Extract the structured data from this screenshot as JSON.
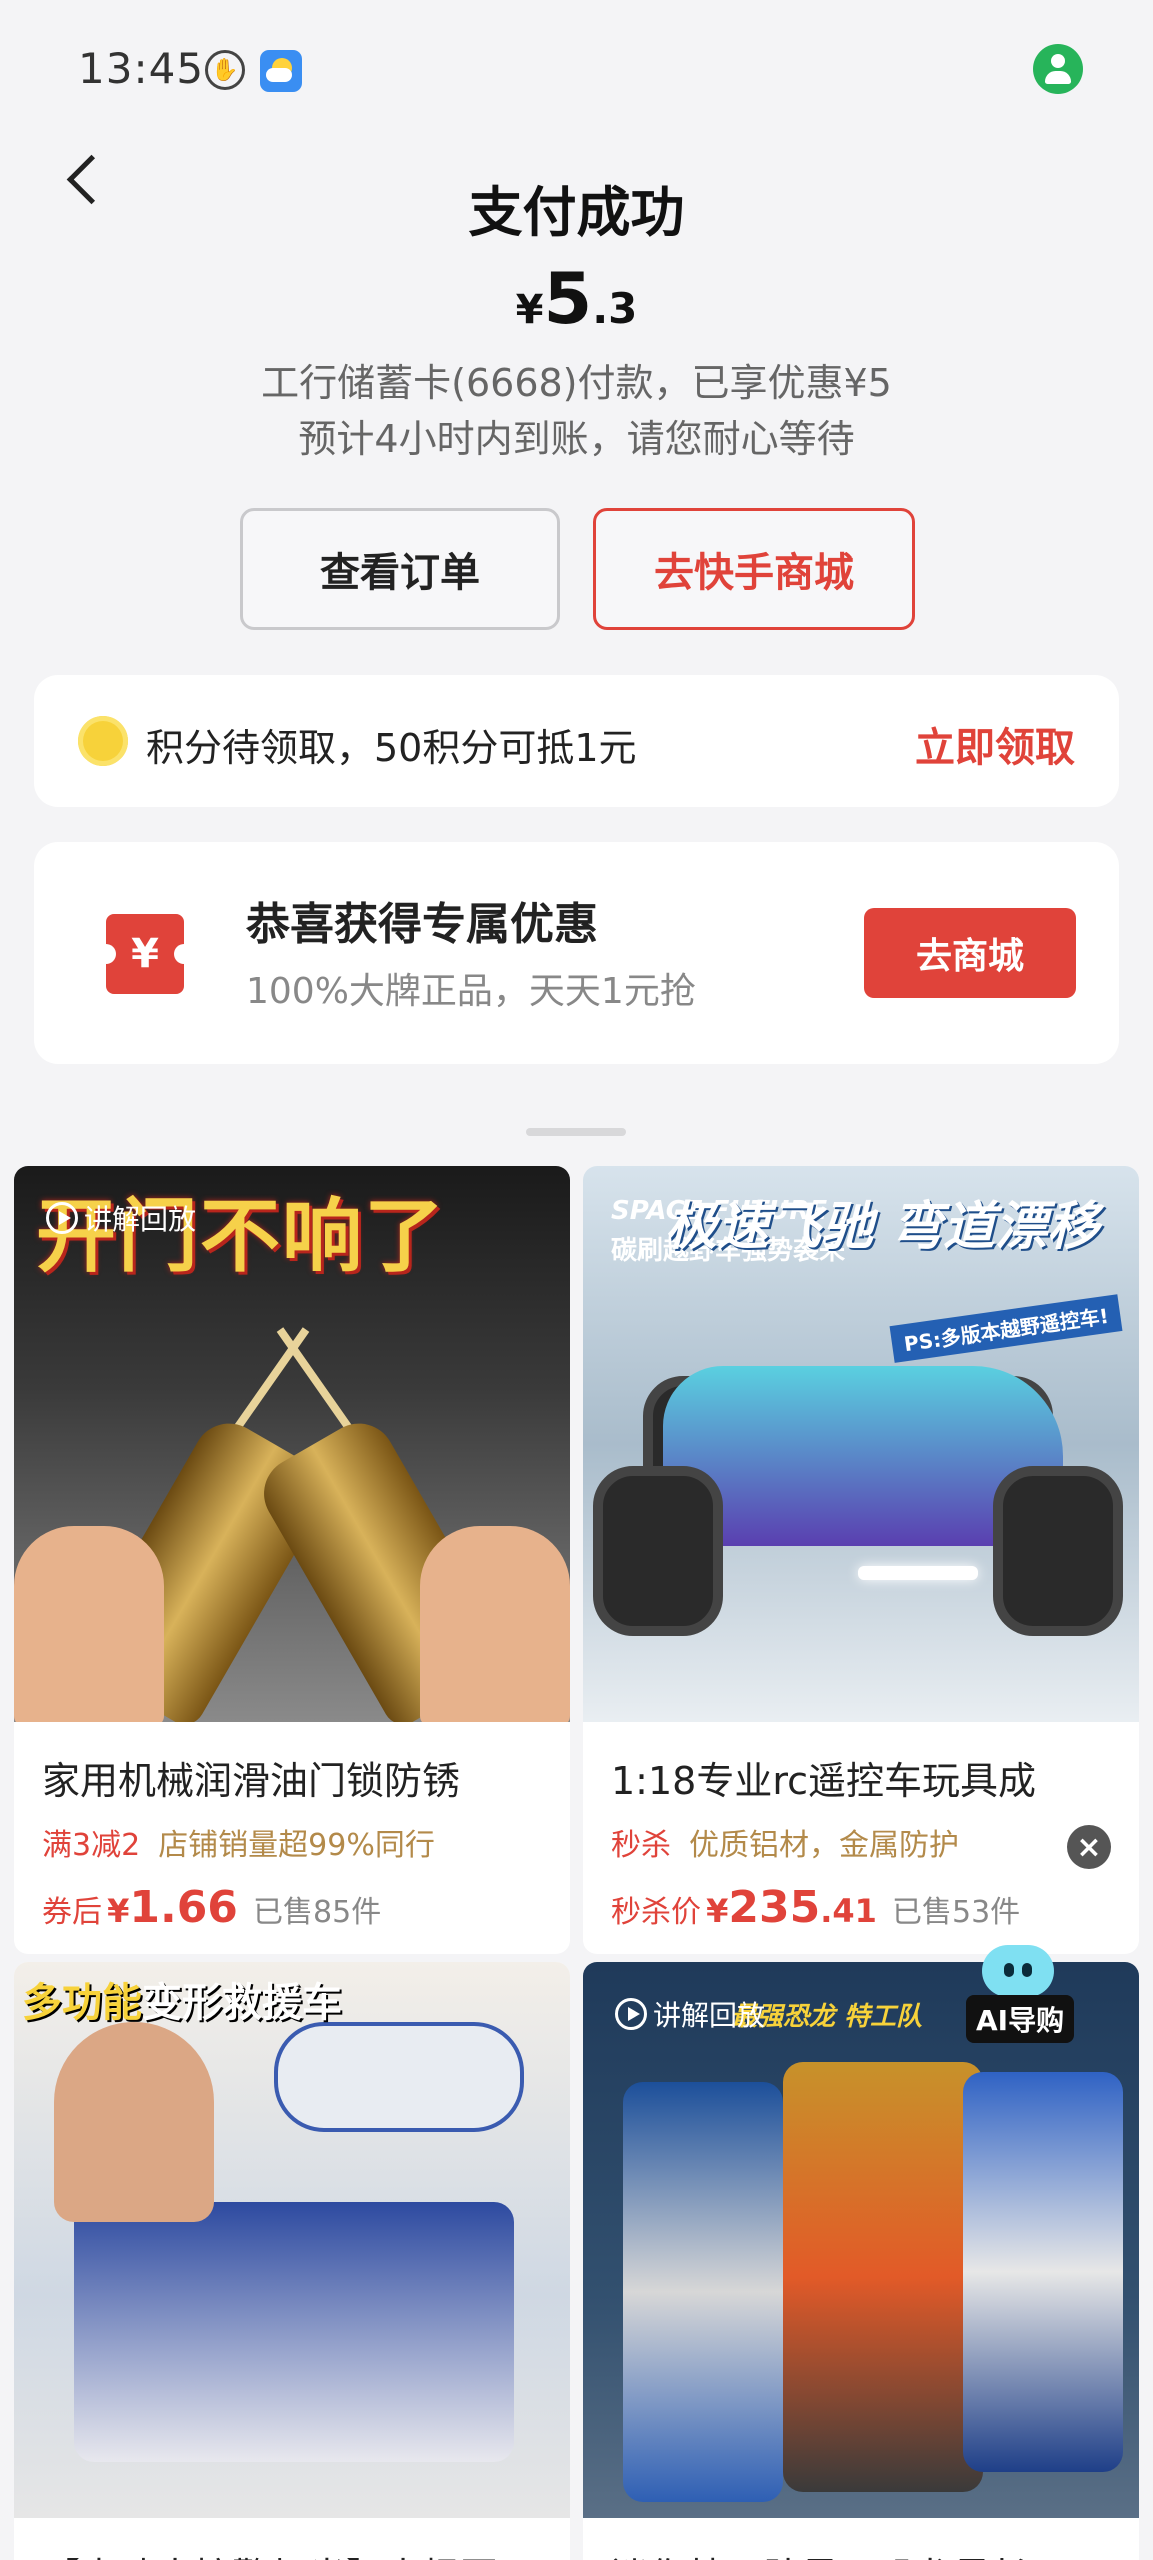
{
  "status_bar": {
    "time": "13:45"
  },
  "header": {
    "title": "支付成功",
    "currency": "¥",
    "amount_int": "5",
    "amount_dec": ".3",
    "pay_line1": "工行储蓄卡(6668)付款，已享优惠¥5",
    "pay_line2": "预计4小时内到账，请您耐心等待"
  },
  "actions": {
    "view_order": "查看订单",
    "go_mall": "去快手商城"
  },
  "points": {
    "text": "积分待领取，50积分可抵1元",
    "claim": "立即领取"
  },
  "coupon": {
    "icon_text": "¥",
    "title": "恭喜获得专属优惠",
    "subtitle": "100%大牌正品，天天1元抢",
    "button": "去商城"
  },
  "products": [
    {
      "replay": "讲解回放",
      "banner": "开门不响了",
      "title": "家用机械润滑油门锁防锈",
      "tag_red": "满3减2",
      "tag_brown": "店铺销量超99%同行",
      "price_label": "券后",
      "price_cur": "¥",
      "price_int": "1.66",
      "price_dec": "",
      "sold": "已售85件"
    },
    {
      "banner_en": "SPACE FUTURE",
      "banner_sub": "碳刷越野车强势袭来",
      "banner_right": "极速飞驰 弯道漂移",
      "ps": "PS:多版本越野遥控车!",
      "title": "1:18专业rc遥控车玩具成",
      "tag_red": "秒杀",
      "tag_brown": "优质铝材，金属防护",
      "price_label": "秒杀价",
      "price_cur": "¥",
      "price_int": "235",
      "price_dec": ".41",
      "sold": "已售53件"
    },
    {
      "banner_highlight": "多功能",
      "banner_rest": "变形救援车",
      "title": "【声晴大控警灯光】大根园"
    },
    {
      "replay": "讲解回放",
      "wild_tag": "最强恐龙 特工队",
      "title": "迷你特工队最强恐龙最长"
    }
  ],
  "ai": {
    "label": "AI导购"
  },
  "close": {
    "symbol": "×"
  }
}
